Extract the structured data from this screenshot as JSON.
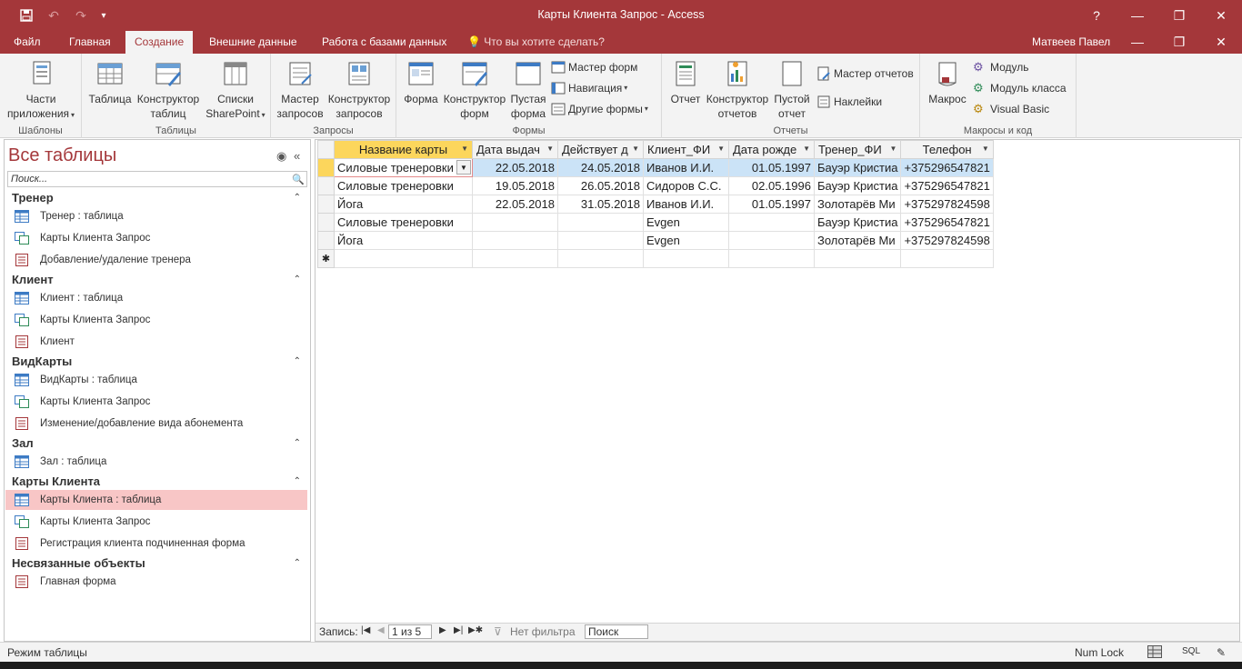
{
  "window": {
    "title": "Карты Клиента Запрос - Access",
    "help": "?",
    "minimize": "—",
    "restore": "❐",
    "close": "✕"
  },
  "quick_access": {
    "save": "💾",
    "undo": "↶",
    "redo": "↷",
    "more": "▾"
  },
  "ribbon_tabs": [
    {
      "label": "Файл"
    },
    {
      "label": "Главная"
    },
    {
      "label": "Создание"
    },
    {
      "label": "Внешние данные"
    },
    {
      "label": "Работа с базами данных"
    }
  ],
  "tell_me": "Что вы хотите сделать?",
  "user_name": "Матвеев Павел",
  "ribbon": {
    "groups": {
      "templates": "Шаблоны",
      "tables": "Таблицы",
      "queries": "Запросы",
      "forms": "Формы",
      "reports": "Отчеты",
      "macros": "Макросы и код"
    },
    "buttons": {
      "app_parts_1": "Части",
      "app_parts_2": "приложения",
      "table": "Таблица",
      "table_design_1": "Конструктор",
      "table_design_2": "таблиц",
      "sharepoint_1": "Списки",
      "sharepoint_2": "SharePoint",
      "query_wizard_1": "Мастер",
      "query_wizard_2": "запросов",
      "query_design_1": "Конструктор",
      "query_design_2": "запросов",
      "form": "Форма",
      "form_design_1": "Конструктор",
      "form_design_2": "форм",
      "blank_form_1": "Пустая",
      "blank_form_2": "форма",
      "form_wizard": "Мастер форм",
      "navigation": "Навигация",
      "more_forms": "Другие формы",
      "report": "Отчет",
      "report_design_1": "Конструктор",
      "report_design_2": "отчетов",
      "blank_report_1": "Пустой",
      "blank_report_2": "отчет",
      "report_wizard": "Мастер отчетов",
      "labels": "Наклейки",
      "macro": "Макрос",
      "module": "Модуль",
      "class_module": "Модуль класса",
      "visual_basic": "Visual Basic"
    }
  },
  "nav_pane": {
    "title": "Все таблицы",
    "search_placeholder": "Поиск...",
    "groups": [
      {
        "name": "Тренер",
        "items": [
          "Тренер : таблица",
          "Карты Клиента Запрос",
          "Добавление/удаление тренера"
        ]
      },
      {
        "name": "Клиент",
        "items": [
          "Клиент : таблица",
          "Карты Клиента Запрос",
          "Клиент"
        ]
      },
      {
        "name": "ВидКарты",
        "items": [
          "ВидКарты : таблица",
          "Карты Клиента Запрос",
          "Изменение/добавление вида абонемента"
        ]
      },
      {
        "name": "Зал",
        "items": [
          "Зал : таблица"
        ]
      },
      {
        "name": "Карты Клиента",
        "items": [
          "Карты Клиента : таблица",
          "Карты Клиента Запрос",
          "Регистрация клиента подчиненная форма"
        ]
      },
      {
        "name": "Несвязанные объекты",
        "items": [
          "Главная форма"
        ]
      }
    ]
  },
  "datasheet": {
    "columns": [
      "Название карты",
      "Дата выдач",
      "Действует д",
      "Клиент_ФИ",
      "Дата рожде",
      "Тренер_ФИ",
      "Телефон"
    ],
    "rows": [
      [
        "Силовые тренеровки",
        "22.05.2018",
        "24.05.2018",
        "Иванов И.И.",
        "01.05.1997",
        "Бауэр Кристиа",
        "+375296547821"
      ],
      [
        "Силовые тренеровки",
        "19.05.2018",
        "26.05.2018",
        "Сидоров С.С.",
        "02.05.1996",
        "Бауэр Кристиа",
        "+375296547821"
      ],
      [
        "Йога",
        "22.05.2018",
        "31.05.2018",
        "Иванов И.И.",
        "01.05.1997",
        "Золотарёв Ми",
        "+375297824598"
      ],
      [
        "Силовые тренеровки",
        "",
        "",
        "Evgen",
        "",
        "Бауэр Кристиа",
        "+375296547821"
      ],
      [
        "Йога",
        "",
        "",
        "Evgen",
        "",
        "Золотарёв Ми",
        "+375297824598"
      ]
    ],
    "new_row_marker": "✱"
  },
  "record_nav": {
    "label": "Запись:",
    "position": "1 из 5",
    "filter": "Нет фильтра",
    "search": "Поиск"
  },
  "status_bar": {
    "mode": "Режим таблицы",
    "num_lock": "Num Lock",
    "sql": "SQL"
  }
}
